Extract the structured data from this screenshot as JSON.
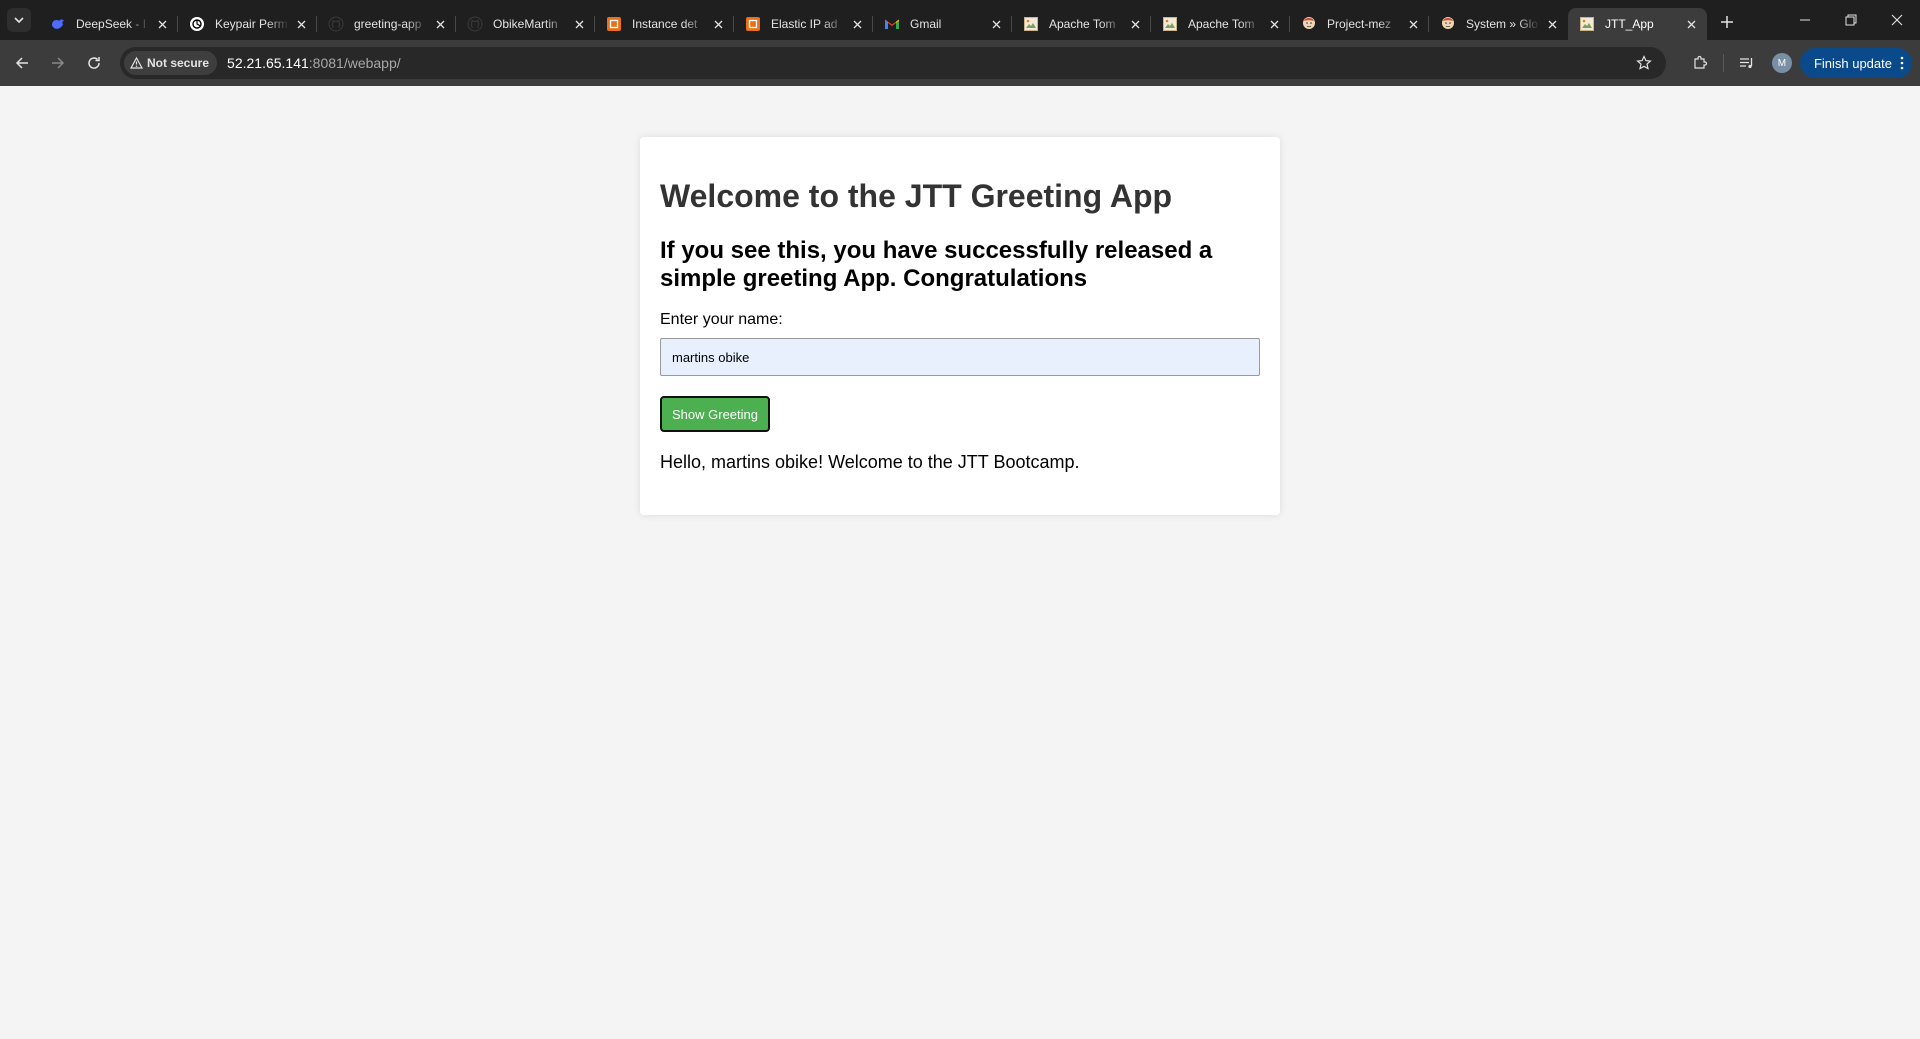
{
  "browser": {
    "tabs": [
      {
        "title": "DeepSeek - I",
        "icon": "deepseek-icon",
        "active": false
      },
      {
        "title": "Keypair Perm",
        "icon": "openai-icon",
        "active": false
      },
      {
        "title": "greeting-app",
        "icon": "github-icon",
        "active": false
      },
      {
        "title": "ObikeMartin",
        "icon": "github-icon",
        "active": false
      },
      {
        "title": "Instance det",
        "icon": "aws-icon",
        "active": false
      },
      {
        "title": "Elastic IP ad",
        "icon": "aws-icon",
        "active": false
      },
      {
        "title": "Gmail",
        "icon": "gmail-icon",
        "active": false
      },
      {
        "title": "Apache Tom",
        "icon": "broken-image-icon",
        "active": false
      },
      {
        "title": "Apache Tom",
        "icon": "broken-image-icon",
        "active": false
      },
      {
        "title": "Project-mez",
        "icon": "jenkins-icon",
        "active": false
      },
      {
        "title": "System » Glo",
        "icon": "jenkins-icon",
        "active": false
      },
      {
        "title": "JTT_App",
        "icon": "broken-image-icon",
        "active": true
      }
    ],
    "security_label": "Not secure",
    "url_host": "52.21.65.141",
    "url_rest": ":8081/webapp/",
    "avatar_letter": "M",
    "finish_update_label": "Finish update"
  },
  "page": {
    "heading": "Welcome to the JTT Greeting App",
    "subheading": "If you see this, you have successfully released a simple greeting App. Congratulations",
    "name_label": "Enter your name:",
    "name_value": "martins obike",
    "button_label": "Show Greeting",
    "greeting": "Hello, martins obike! Welcome to the JTT Bootcamp."
  },
  "colors": {
    "button": "#4caf50",
    "input_autofill": "#e8f0fe",
    "page_bg": "#f4f4f4"
  }
}
